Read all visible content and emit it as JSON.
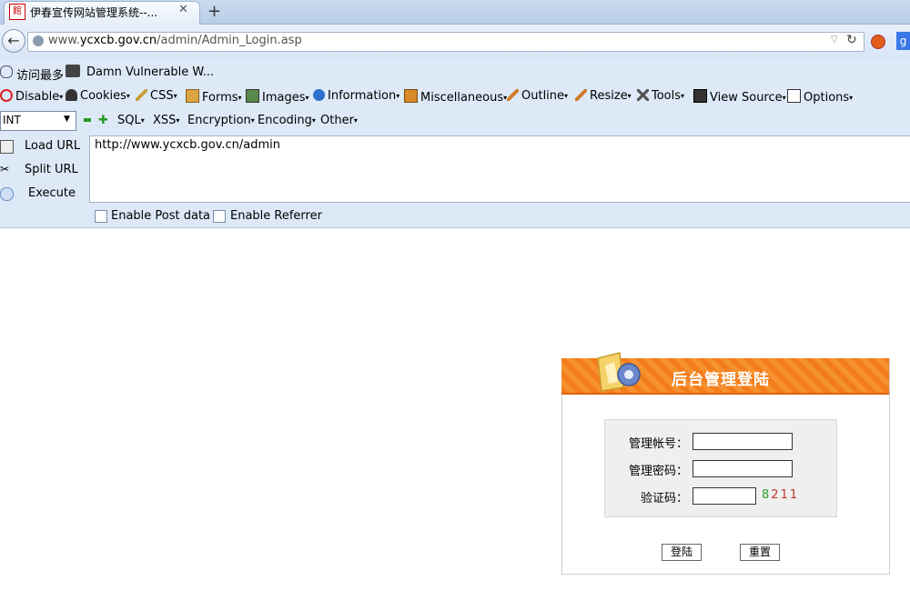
{
  "browser": {
    "tab_title": "伊春宣传网站管理系统--...",
    "tab_favicon": "館",
    "url_prefix": "www.",
    "url_domain": "ycxcb.gov.cn",
    "url_path": "/admin/Admin_Login.asp"
  },
  "bookmarks": [
    {
      "label": "访问最多"
    },
    {
      "label": "Damn Vulnerable W..."
    }
  ],
  "hackbar": {
    "menu": [
      {
        "label": "Disable",
        "icon": "disable-icon"
      },
      {
        "label": "Cookies",
        "icon": "cookies-icon"
      },
      {
        "label": "CSS",
        "icon": "css-icon"
      },
      {
        "label": "Forms",
        "icon": "forms-icon"
      },
      {
        "label": "Images",
        "icon": "images-icon"
      },
      {
        "label": "Information",
        "icon": "information-icon"
      },
      {
        "label": "Miscellaneous",
        "icon": "miscellaneous-icon"
      },
      {
        "label": "Outline",
        "icon": "outline-icon"
      },
      {
        "label": "Resize",
        "icon": "resize-icon"
      },
      {
        "label": "Tools",
        "icon": "tools-icon"
      },
      {
        "label": "View Source",
        "icon": "view-source-icon"
      },
      {
        "label": "Options",
        "icon": "options-icon"
      }
    ],
    "select_value": "INT",
    "row2": [
      {
        "label": "SQL"
      },
      {
        "label": "XSS"
      },
      {
        "label": "Encryption"
      },
      {
        "label": "Encoding"
      },
      {
        "label": "Other"
      }
    ],
    "actions": [
      {
        "label": "Load URL"
      },
      {
        "label": "Split URL"
      },
      {
        "label": "Execute"
      }
    ],
    "url_value": "http://www.ycxcb.gov.cn/admin",
    "enable_post": "Enable Post data",
    "enable_referrer": "Enable Referrer"
  },
  "login": {
    "title": "后台管理登陆",
    "account_label": "管理帐号：",
    "password_label": "管理密码：",
    "captcha_label": "验证码：",
    "captcha_digits": [
      "8",
      "2",
      "1",
      "1"
    ],
    "captcha_colors": [
      "#2e9d2e",
      "#c0392b",
      "#c0392b",
      "#c0392b"
    ],
    "login_button": "登陆",
    "reset_button": "重置",
    "accent": "#f37d1a"
  }
}
